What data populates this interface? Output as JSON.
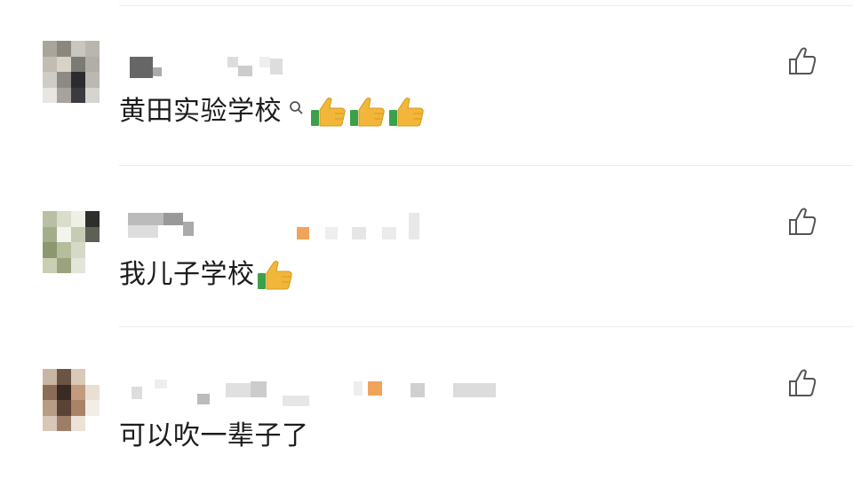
{
  "comments": [
    {
      "text": "黄田实验学校",
      "has_search_icon": true,
      "emoji": [
        "thumbs-up",
        "thumbs-up",
        "thumbs-up"
      ],
      "like_icon": "thumbs-up-outline-icon"
    },
    {
      "text": "我儿子学校",
      "has_search_icon": false,
      "emoji": [
        "thumbs-up"
      ],
      "like_icon": "thumbs-up-outline-icon"
    },
    {
      "text": "可以吹一辈子了",
      "has_search_icon": false,
      "emoji": [],
      "like_icon": "thumbs-up-outline-icon"
    }
  ],
  "colors": {
    "text": "#1c1c1c",
    "separator": "#ececec",
    "icon": "#555555",
    "emoji_thumb": "#f2b73a",
    "emoji_cuff": "#3aa14a"
  }
}
